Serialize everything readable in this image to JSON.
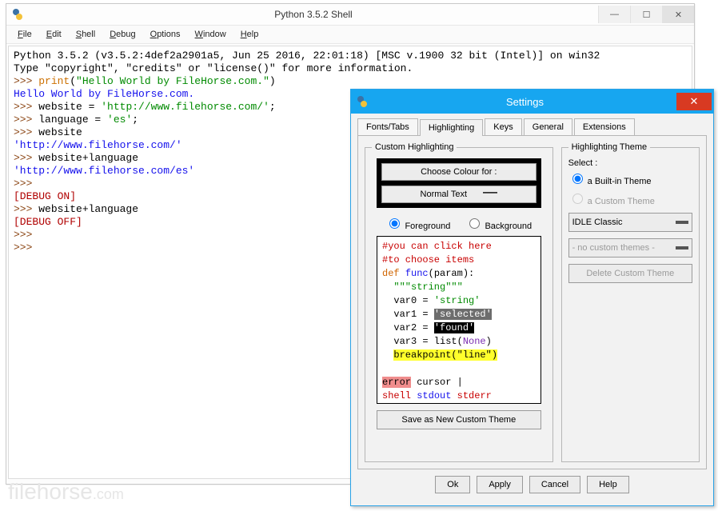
{
  "shell": {
    "title": "Python 3.5.2 Shell",
    "menu": {
      "file": "File",
      "edit": "Edit",
      "shell": "Shell",
      "debug": "Debug",
      "options": "Options",
      "window": "Window",
      "help": "Help"
    },
    "lines": {
      "banner1": "Python 3.5.2 (v3.5.2:4def2a2901a5, Jun 25 2016, 22:01:18) [MSC v.1900 32 bit (Intel)] on win32",
      "banner2": "Type \"copyright\", \"credits\" or \"license()\" for more information.",
      "prompt": ">>> ",
      "print_kw": "print",
      "print_open": "(",
      "print_arg": "\"Hello World by FileHorse.com.\"",
      "print_close": ")",
      "out_hello": "Hello World by FileHorse.com.",
      "assign_site": "website = ",
      "site_val": "'http://www.filehorse.com/'",
      "semicolon": ";",
      "assign_lang": "language = ",
      "lang_val": "'es'",
      "echo_site_cmd": "website",
      "echo_site": "'http://www.filehorse.com/'",
      "concat_cmd": "website+language",
      "echo_concat": "'http://www.filehorse.com/es'",
      "debug_on": "[DEBUG ON]",
      "debug_off": "[DEBUG OFF]"
    }
  },
  "watermark": {
    "main": "filehorse",
    "tld": ".com"
  },
  "dialog": {
    "title": "Settings",
    "tabs": {
      "fonts": "Fonts/Tabs",
      "hl": "Highlighting",
      "keys": "Keys",
      "gen": "General",
      "ext": "Extensions"
    },
    "left": {
      "legend": "Custom Highlighting",
      "choose": "Choose Colour for :",
      "kind": "Normal Text",
      "fg": "Foreground",
      "bg": "Background",
      "preview": {
        "c1": "#you can click here",
        "c2": "#to choose items",
        "def": "def",
        "func": "func",
        "sig": "(param):",
        "doc": "  \"\"\"string\"\"\"",
        "v0pre": "  var0 = ",
        "v0str": "'string'",
        "v1pre": "  var1 = ",
        "v1sel": "'selected'",
        "v2pre": "  var2 = ",
        "v2fnd": "'found'",
        "v3pre": "  var3 = list(",
        "v3none": "None",
        "v3post": ")",
        "bppre": "  ",
        "bp": "breakpoint(\"line\")",
        "blank": " ",
        "err": "error",
        "errrest": " cursor |",
        "shell": "shell ",
        "stdout": "stdout ",
        "stderr": "stderr"
      },
      "save": "Save as New Custom Theme"
    },
    "right": {
      "legend": "Highlighting Theme",
      "select": "Select :",
      "builtin": "a Built-in Theme",
      "custom": "a Custom Theme",
      "theme": "IDLE Classic",
      "nocustom": "- no custom themes -",
      "delete": "Delete Custom Theme"
    },
    "buttons": {
      "ok": "Ok",
      "apply": "Apply",
      "cancel": "Cancel",
      "help": "Help"
    }
  }
}
